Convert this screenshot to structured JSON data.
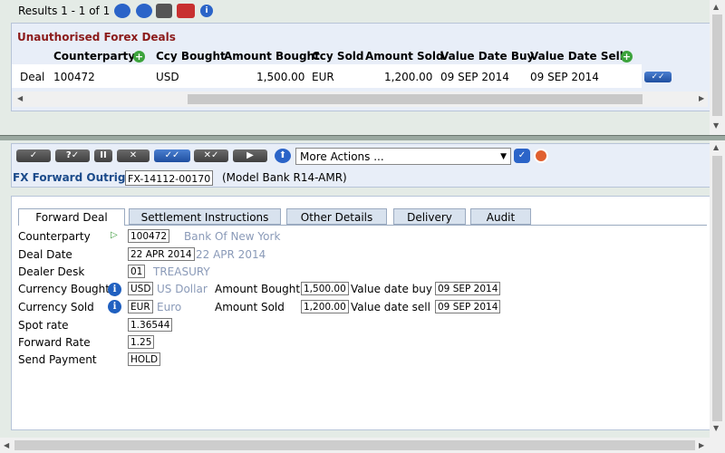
{
  "results": {
    "text": "Results 1 - 1 of 1"
  },
  "deals": {
    "title": "Unauthorised Forex Deals",
    "headers": [
      "Counterparty",
      "Ccy Bought",
      "Amount Bought",
      "Ccy Sold",
      "Amount Sold",
      "Value Date Buy",
      "Value Date Sell"
    ],
    "row": {
      "label": "Deal",
      "id": "100472",
      "ccy_bought": "USD",
      "amount_bought": "1,500.00",
      "ccy_sold": "EUR",
      "amount_sold": "1,200.00",
      "value_date_buy": "09 SEP 2014",
      "value_date_sell": "09 SEP 2014"
    }
  },
  "toolbar": {
    "more_actions": "More Actions ..."
  },
  "form": {
    "title": "FX Forward Outright",
    "ref": "FX-14112-00170",
    "model": "(Model Bank R14-AMR)",
    "tabs": [
      "Forward Deal",
      "Settlement Instructions",
      "Other Details",
      "Delivery",
      "Audit"
    ],
    "labels": {
      "counterparty": "Counterparty",
      "deal_date": "Deal Date",
      "dealer_desk": "Dealer Desk",
      "currency_bought": "Currency Bought",
      "currency_sold": "Currency Sold",
      "spot_rate": "Spot rate",
      "forward_rate": "Forward Rate",
      "send_payment": "Send Payment",
      "amount_bought": "Amount Bought",
      "amount_sold": "Amount Sold",
      "value_date_buy": "Value date buy",
      "value_date_sell": "Value date sell"
    },
    "values": {
      "counterparty": "100472",
      "counterparty_name": "Bank Of New York",
      "deal_date": "22 APR 2014",
      "deal_date_enr": "22 APR 2014",
      "dealer_desk": "01",
      "dealer_desk_name": "TREASURY",
      "currency_bought": "USD",
      "currency_bought_name": "US Dollar",
      "currency_sold": "EUR",
      "currency_sold_name": "Euro",
      "amount_bought": "1,500.00",
      "amount_sold": "1,200.00",
      "value_date_buy": "09 SEP 2014",
      "value_date_sell": "09 SEP 2014",
      "spot_rate": "1.36544",
      "forward_rate": "1.25",
      "send_payment": "HOLD"
    }
  },
  "colors": {
    "title_red": "#8b1a1a",
    "title_blue": "#1a4a8a",
    "panel_bg": "#e8eef8",
    "frame_bg": "#e4ebe6"
  }
}
